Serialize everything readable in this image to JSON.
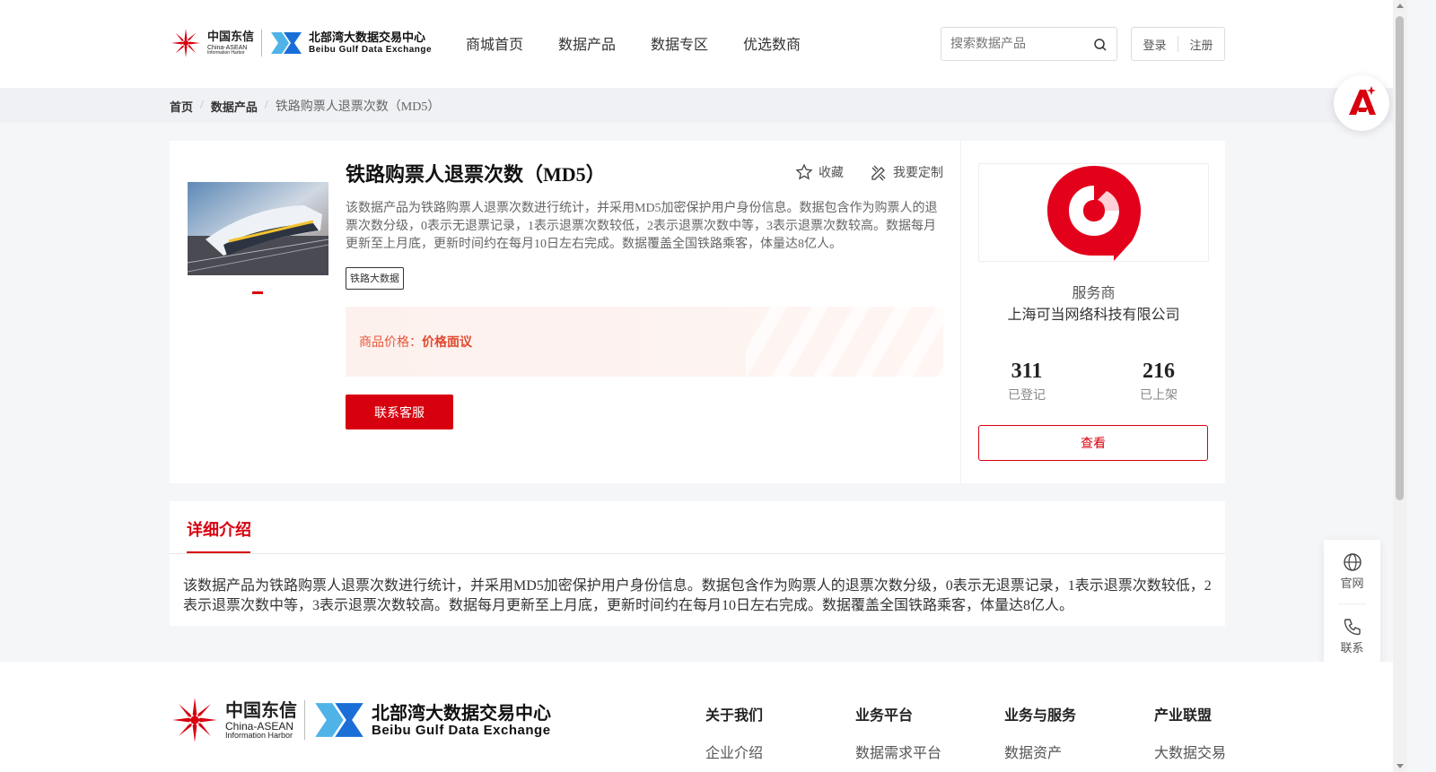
{
  "header": {
    "logo": {
      "cn_name": "中国东信",
      "cn_sub1": "China-ASEAN",
      "cn_sub2": "Information Harbor",
      "bg_name": "北部湾大数据交易中心",
      "bg_sub": "Beibu Gulf Data Exchange"
    },
    "nav": [
      {
        "label": "商城首页"
      },
      {
        "label": "数据产品"
      },
      {
        "label": "数据专区"
      },
      {
        "label": "优选数商"
      }
    ],
    "search": {
      "placeholder": "搜索数据产品"
    },
    "auth": {
      "login": "登录",
      "register": "注册"
    }
  },
  "breadcrumb": {
    "home": "首页",
    "section": "数据产品",
    "current": "铁路购票人退票次数（MD5）",
    "separator": "/"
  },
  "product": {
    "title": "铁路购票人退票次数（MD5）",
    "favorite_label": "收藏",
    "customize_label": "我要定制",
    "description": "该数据产品为铁路购票人退票次数进行统计，并采用MD5加密保护用户身份信息。数据包含作为购票人的退票次数分级，0表示无退票记录，1表示退票次数较低，2表示退票次数中等，3表示退票次数较高。数据每月更新至上月底，更新时间约在每月10日左右完成。数据覆盖全国铁路乘客，体量达8亿人。",
    "tag": "铁路大数据",
    "price_label": "商品价格：",
    "price_value": "价格面议",
    "contact_button": "联系客服"
  },
  "provider": {
    "label": "服务商",
    "name": "上海可当网络科技有限公司",
    "registered_count": "311",
    "registered_label": "已登记",
    "listed_count": "216",
    "listed_label": "已上架",
    "view_button": "查看"
  },
  "detail": {
    "tab_label": "详细介绍",
    "text": "该数据产品为铁路购票人退票次数进行统计，并采用MD5加密保护用户身份信息。数据包含作为购票人的退票次数分级，0表示无退票记录，1表示退票次数较低，2表示退票次数中等，3表示退票次数较高。数据每月更新至上月底，更新时间约在每月10日左右完成。数据覆盖全国铁路乘客，体量达8亿人。"
  },
  "side_float": {
    "website_label": "官网",
    "contact_label": "联系"
  },
  "footer": {
    "columns": [
      {
        "heading": "关于我们",
        "item": "企业介绍"
      },
      {
        "heading": "业务平台",
        "item": "数据需求平台"
      },
      {
        "heading": "业务与服务",
        "item": "数据资产"
      },
      {
        "heading": "产业联盟",
        "item": "大数据交易"
      }
    ]
  },
  "colors": {
    "brand_red": "#d7000f",
    "price_orange": "#e8563a",
    "logo_blue": "#1a6fd6"
  }
}
